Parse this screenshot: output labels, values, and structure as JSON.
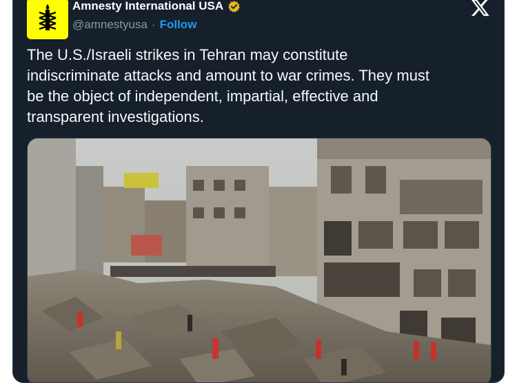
{
  "account": {
    "name": "Amnesty International USA",
    "handle": "@amnestyusa",
    "separator": "·",
    "follow_label": "Follow",
    "verified_badge": "gold-verified-icon",
    "avatar_icon": "candle-in-barbed-wire-icon",
    "avatar_color": "#ffff00"
  },
  "platform_logo": "x-logo-icon",
  "tweet": {
    "line1": "The U.S./Israeli strikes in Tehran may constitute",
    "line2": "indiscriminate attacks and amount to war crimes. They must",
    "line3": "be the object of independent, impartial, effective and",
    "line4": "transparent investigations."
  },
  "media": {
    "subject": "photo of collapsed buildings and rubble with rescue workers"
  },
  "colors": {
    "card_bg": "#15202b",
    "text": "#f7f9f9",
    "muted": "#8b98a5",
    "link": "#1d9bf0",
    "verified_gold": "#e2b719"
  }
}
